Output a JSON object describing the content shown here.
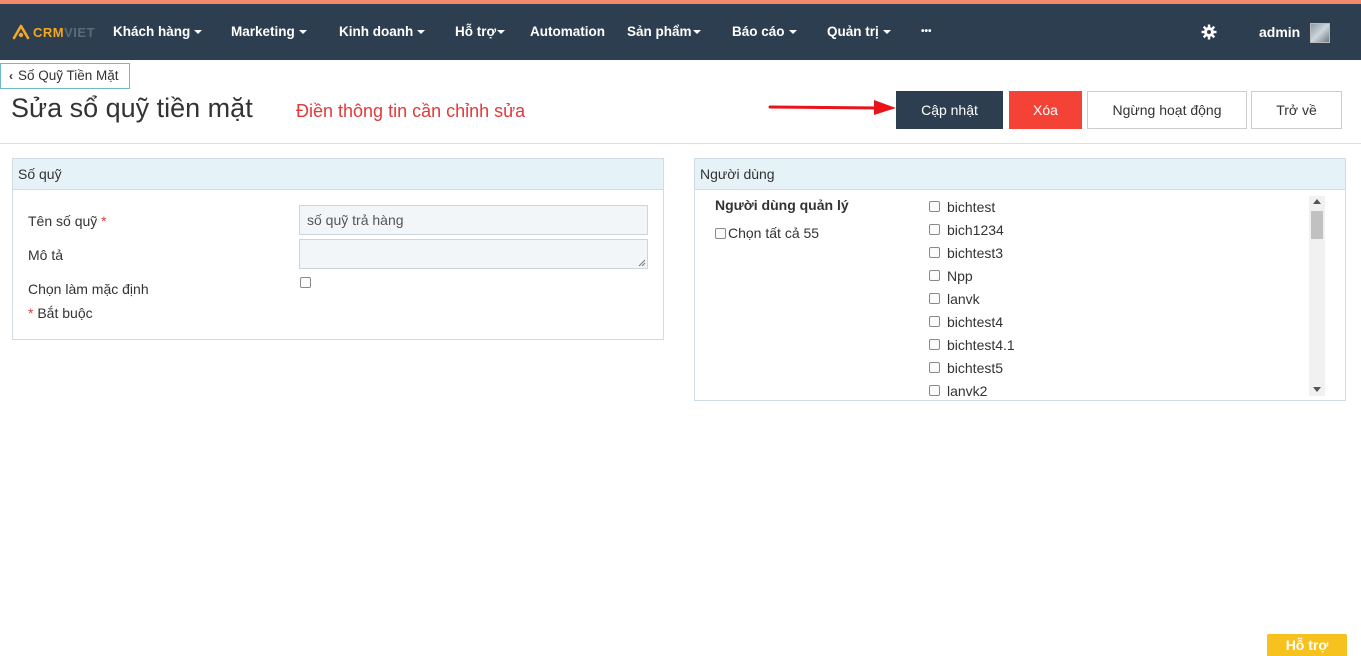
{
  "navbar": {
    "logo": {
      "part1": "CRM",
      "part2": "VIET"
    },
    "items": [
      {
        "label": "Khách hàng",
        "dropdown": true
      },
      {
        "label": "Marketing",
        "dropdown": true
      },
      {
        "label": "Kinh doanh",
        "dropdown": true
      },
      {
        "label": "Hỗ trợ",
        "dropdown": true
      },
      {
        "label": "Automation",
        "dropdown": false
      },
      {
        "label": "Sản phẩm",
        "dropdown": true
      },
      {
        "label": "Báo cáo",
        "dropdown": true
      },
      {
        "label": "Quản trị",
        "dropdown": true
      },
      {
        "label": "•••",
        "dropdown": false
      }
    ],
    "settings_icon": "gear-icon",
    "user": "admin",
    "colors": {
      "bg": "#2d3e50",
      "accent": "#f5a623"
    }
  },
  "breadcrumb": {
    "back_label": "Số Quỹ Tiền Mặt"
  },
  "page": {
    "title": "Sửa sổ quỹ tiền mặt",
    "hint": "Điền thông tin cần chỉnh sửa"
  },
  "actions": {
    "update": "Cập nhật",
    "delete": "Xóa",
    "deactivate": "Ngừng hoạt động",
    "back": "Trở về"
  },
  "fund_panel": {
    "title": "Số quỹ",
    "name_label": "Tên số quỹ",
    "required_mark": "*",
    "name_value": "số quỹ trả hàng",
    "description_label": "Mô tả",
    "description_value": "",
    "default_label": "Chọn làm mặc định",
    "default_checked": false,
    "required_note": "Bắt buộc"
  },
  "users_panel": {
    "title": "Người dùng",
    "managers_label": "Người dùng quản lý",
    "select_all_label": "Chọn tất cả 55",
    "users": [
      "bichtest",
      "bich1234",
      "bichtest3",
      "Npp",
      "lanvk",
      "bichtest4",
      "bichtest4.1",
      "bichtest5",
      "lanvk2"
    ]
  },
  "support_label": "Hỗ trợ"
}
